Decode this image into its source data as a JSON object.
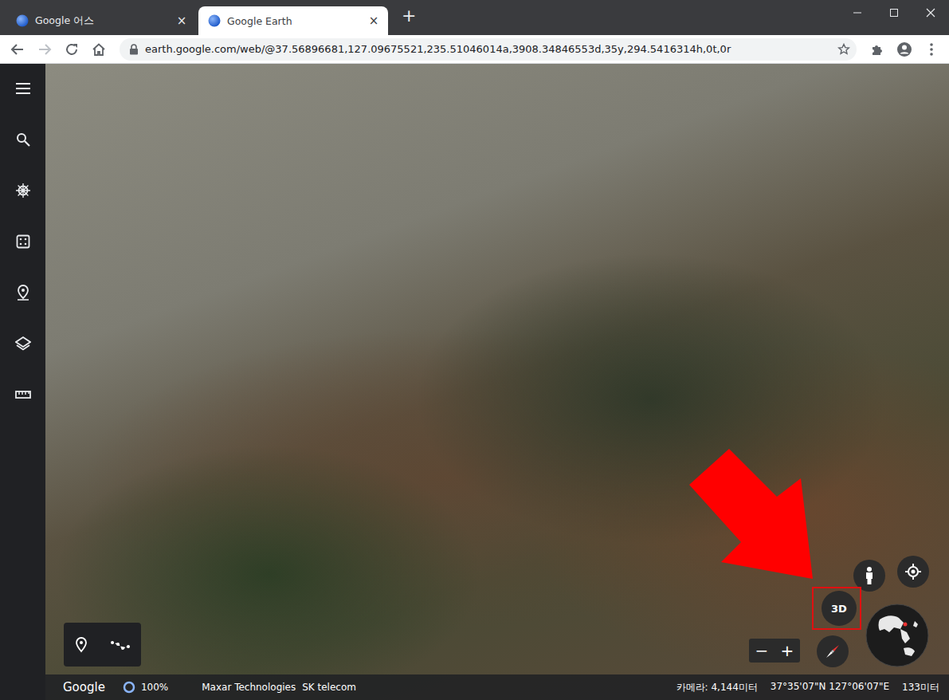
{
  "tabs": [
    {
      "label": "Google 어스",
      "close": "×",
      "selected": false
    },
    {
      "label": "Google Earth",
      "close": "×",
      "selected": true
    }
  ],
  "new_tab": "+",
  "address_bar": {
    "url": "earth.google.com/web/@37.56896681,127.09675521,235.51046014a,3908.34846553d,35y,294.5416314h,0t,0r"
  },
  "map_controls": {
    "view_3d": {
      "label": "3D",
      "highlighted": true
    },
    "zoom_out": "−",
    "zoom_in": "+"
  },
  "status_bar": {
    "logo": "Google",
    "load_percent": "100%",
    "credits": [
      "Maxar Technologies",
      "SK telecom"
    ],
    "camera": "카메라: 4,144미터",
    "coordinates": "37°35'07\"N 127°06'07\"E",
    "elevation": "133미터"
  }
}
